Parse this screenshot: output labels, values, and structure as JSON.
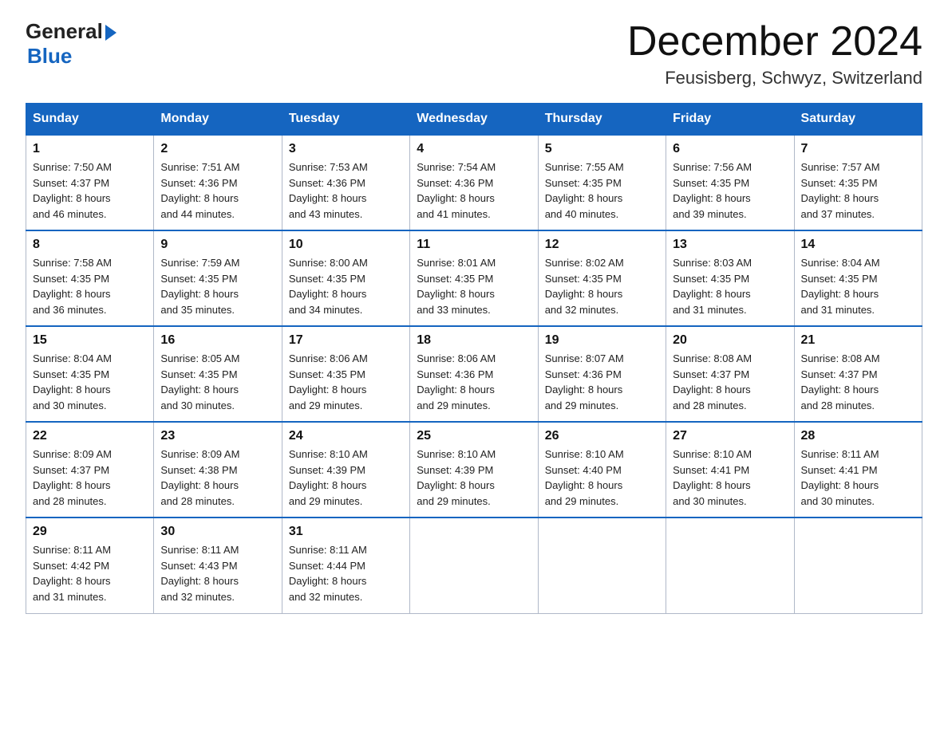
{
  "logo": {
    "general": "General",
    "blue": "Blue"
  },
  "header": {
    "title": "December 2024",
    "subtitle": "Feusisberg, Schwyz, Switzerland"
  },
  "weekdays": [
    "Sunday",
    "Monday",
    "Tuesday",
    "Wednesday",
    "Thursday",
    "Friday",
    "Saturday"
  ],
  "weeks": [
    [
      {
        "day": "1",
        "sunrise": "7:50 AM",
        "sunset": "4:37 PM",
        "daylight": "8 hours and 46 minutes."
      },
      {
        "day": "2",
        "sunrise": "7:51 AM",
        "sunset": "4:36 PM",
        "daylight": "8 hours and 44 minutes."
      },
      {
        "day": "3",
        "sunrise": "7:53 AM",
        "sunset": "4:36 PM",
        "daylight": "8 hours and 43 minutes."
      },
      {
        "day": "4",
        "sunrise": "7:54 AM",
        "sunset": "4:36 PM",
        "daylight": "8 hours and 41 minutes."
      },
      {
        "day": "5",
        "sunrise": "7:55 AM",
        "sunset": "4:35 PM",
        "daylight": "8 hours and 40 minutes."
      },
      {
        "day": "6",
        "sunrise": "7:56 AM",
        "sunset": "4:35 PM",
        "daylight": "8 hours and 39 minutes."
      },
      {
        "day": "7",
        "sunrise": "7:57 AM",
        "sunset": "4:35 PM",
        "daylight": "8 hours and 37 minutes."
      }
    ],
    [
      {
        "day": "8",
        "sunrise": "7:58 AM",
        "sunset": "4:35 PM",
        "daylight": "8 hours and 36 minutes."
      },
      {
        "day": "9",
        "sunrise": "7:59 AM",
        "sunset": "4:35 PM",
        "daylight": "8 hours and 35 minutes."
      },
      {
        "day": "10",
        "sunrise": "8:00 AM",
        "sunset": "4:35 PM",
        "daylight": "8 hours and 34 minutes."
      },
      {
        "day": "11",
        "sunrise": "8:01 AM",
        "sunset": "4:35 PM",
        "daylight": "8 hours and 33 minutes."
      },
      {
        "day": "12",
        "sunrise": "8:02 AM",
        "sunset": "4:35 PM",
        "daylight": "8 hours and 32 minutes."
      },
      {
        "day": "13",
        "sunrise": "8:03 AM",
        "sunset": "4:35 PM",
        "daylight": "8 hours and 31 minutes."
      },
      {
        "day": "14",
        "sunrise": "8:04 AM",
        "sunset": "4:35 PM",
        "daylight": "8 hours and 31 minutes."
      }
    ],
    [
      {
        "day": "15",
        "sunrise": "8:04 AM",
        "sunset": "4:35 PM",
        "daylight": "8 hours and 30 minutes."
      },
      {
        "day": "16",
        "sunrise": "8:05 AM",
        "sunset": "4:35 PM",
        "daylight": "8 hours and 30 minutes."
      },
      {
        "day": "17",
        "sunrise": "8:06 AM",
        "sunset": "4:35 PM",
        "daylight": "8 hours and 29 minutes."
      },
      {
        "day": "18",
        "sunrise": "8:06 AM",
        "sunset": "4:36 PM",
        "daylight": "8 hours and 29 minutes."
      },
      {
        "day": "19",
        "sunrise": "8:07 AM",
        "sunset": "4:36 PM",
        "daylight": "8 hours and 29 minutes."
      },
      {
        "day": "20",
        "sunrise": "8:08 AM",
        "sunset": "4:37 PM",
        "daylight": "8 hours and 28 minutes."
      },
      {
        "day": "21",
        "sunrise": "8:08 AM",
        "sunset": "4:37 PM",
        "daylight": "8 hours and 28 minutes."
      }
    ],
    [
      {
        "day": "22",
        "sunrise": "8:09 AM",
        "sunset": "4:37 PM",
        "daylight": "8 hours and 28 minutes."
      },
      {
        "day": "23",
        "sunrise": "8:09 AM",
        "sunset": "4:38 PM",
        "daylight": "8 hours and 28 minutes."
      },
      {
        "day": "24",
        "sunrise": "8:10 AM",
        "sunset": "4:39 PM",
        "daylight": "8 hours and 29 minutes."
      },
      {
        "day": "25",
        "sunrise": "8:10 AM",
        "sunset": "4:39 PM",
        "daylight": "8 hours and 29 minutes."
      },
      {
        "day": "26",
        "sunrise": "8:10 AM",
        "sunset": "4:40 PM",
        "daylight": "8 hours and 29 minutes."
      },
      {
        "day": "27",
        "sunrise": "8:10 AM",
        "sunset": "4:41 PM",
        "daylight": "8 hours and 30 minutes."
      },
      {
        "day": "28",
        "sunrise": "8:11 AM",
        "sunset": "4:41 PM",
        "daylight": "8 hours and 30 minutes."
      }
    ],
    [
      {
        "day": "29",
        "sunrise": "8:11 AM",
        "sunset": "4:42 PM",
        "daylight": "8 hours and 31 minutes."
      },
      {
        "day": "30",
        "sunrise": "8:11 AM",
        "sunset": "4:43 PM",
        "daylight": "8 hours and 32 minutes."
      },
      {
        "day": "31",
        "sunrise": "8:11 AM",
        "sunset": "4:44 PM",
        "daylight": "8 hours and 32 minutes."
      },
      null,
      null,
      null,
      null
    ]
  ],
  "labels": {
    "sunrise": "Sunrise: ",
    "sunset": "Sunset: ",
    "daylight": "Daylight: "
  }
}
